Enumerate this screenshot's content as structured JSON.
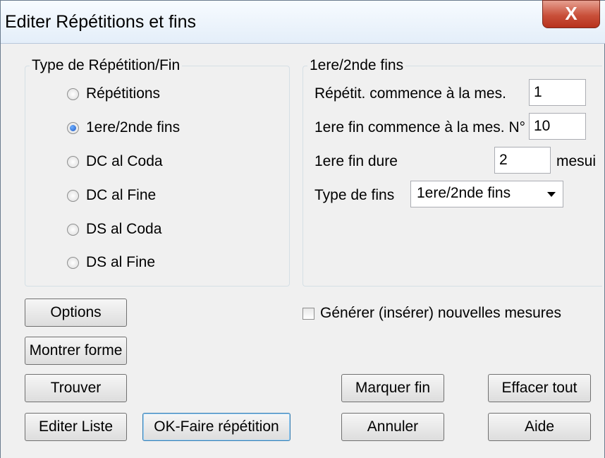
{
  "window": {
    "title": "Editer Répétitions et fins",
    "close_glyph": "X"
  },
  "repeat_type": {
    "legend": "Type de Répétition/Fin",
    "options": [
      {
        "label": "Répétitions",
        "selected": false
      },
      {
        "label": "1ere/2nde fins",
        "selected": true
      },
      {
        "label": "DC al Coda",
        "selected": false
      },
      {
        "label": "DC al Fine",
        "selected": false
      },
      {
        "label": "DS al Coda",
        "selected": false
      },
      {
        "label": "DS al Fine",
        "selected": false
      }
    ]
  },
  "endings": {
    "legend": "1ere/2nde fins",
    "repeat_start_label": "Répétit. commence à la mes.",
    "repeat_start_value": "1",
    "first_ending_label": "1ere fin commence à la mes. N°",
    "first_ending_value": "10",
    "duration_label": "1ere fin dure",
    "duration_value": "2",
    "duration_unit": "mesui",
    "type_label": "Type de fins",
    "type_value": "1ere/2nde fins"
  },
  "generate_checkbox": {
    "label": "Générer (insérer) nouvelles mesures",
    "checked": false
  },
  "buttons": {
    "options": "Options",
    "show_form": "Montrer forme",
    "find": "Trouver",
    "edit_list": "Editer Liste",
    "ok_repeat": "OK-Faire répétition",
    "mark_end": "Marquer fin",
    "clear_all": "Effacer tout",
    "cancel": "Annuler",
    "help": "Aide"
  }
}
